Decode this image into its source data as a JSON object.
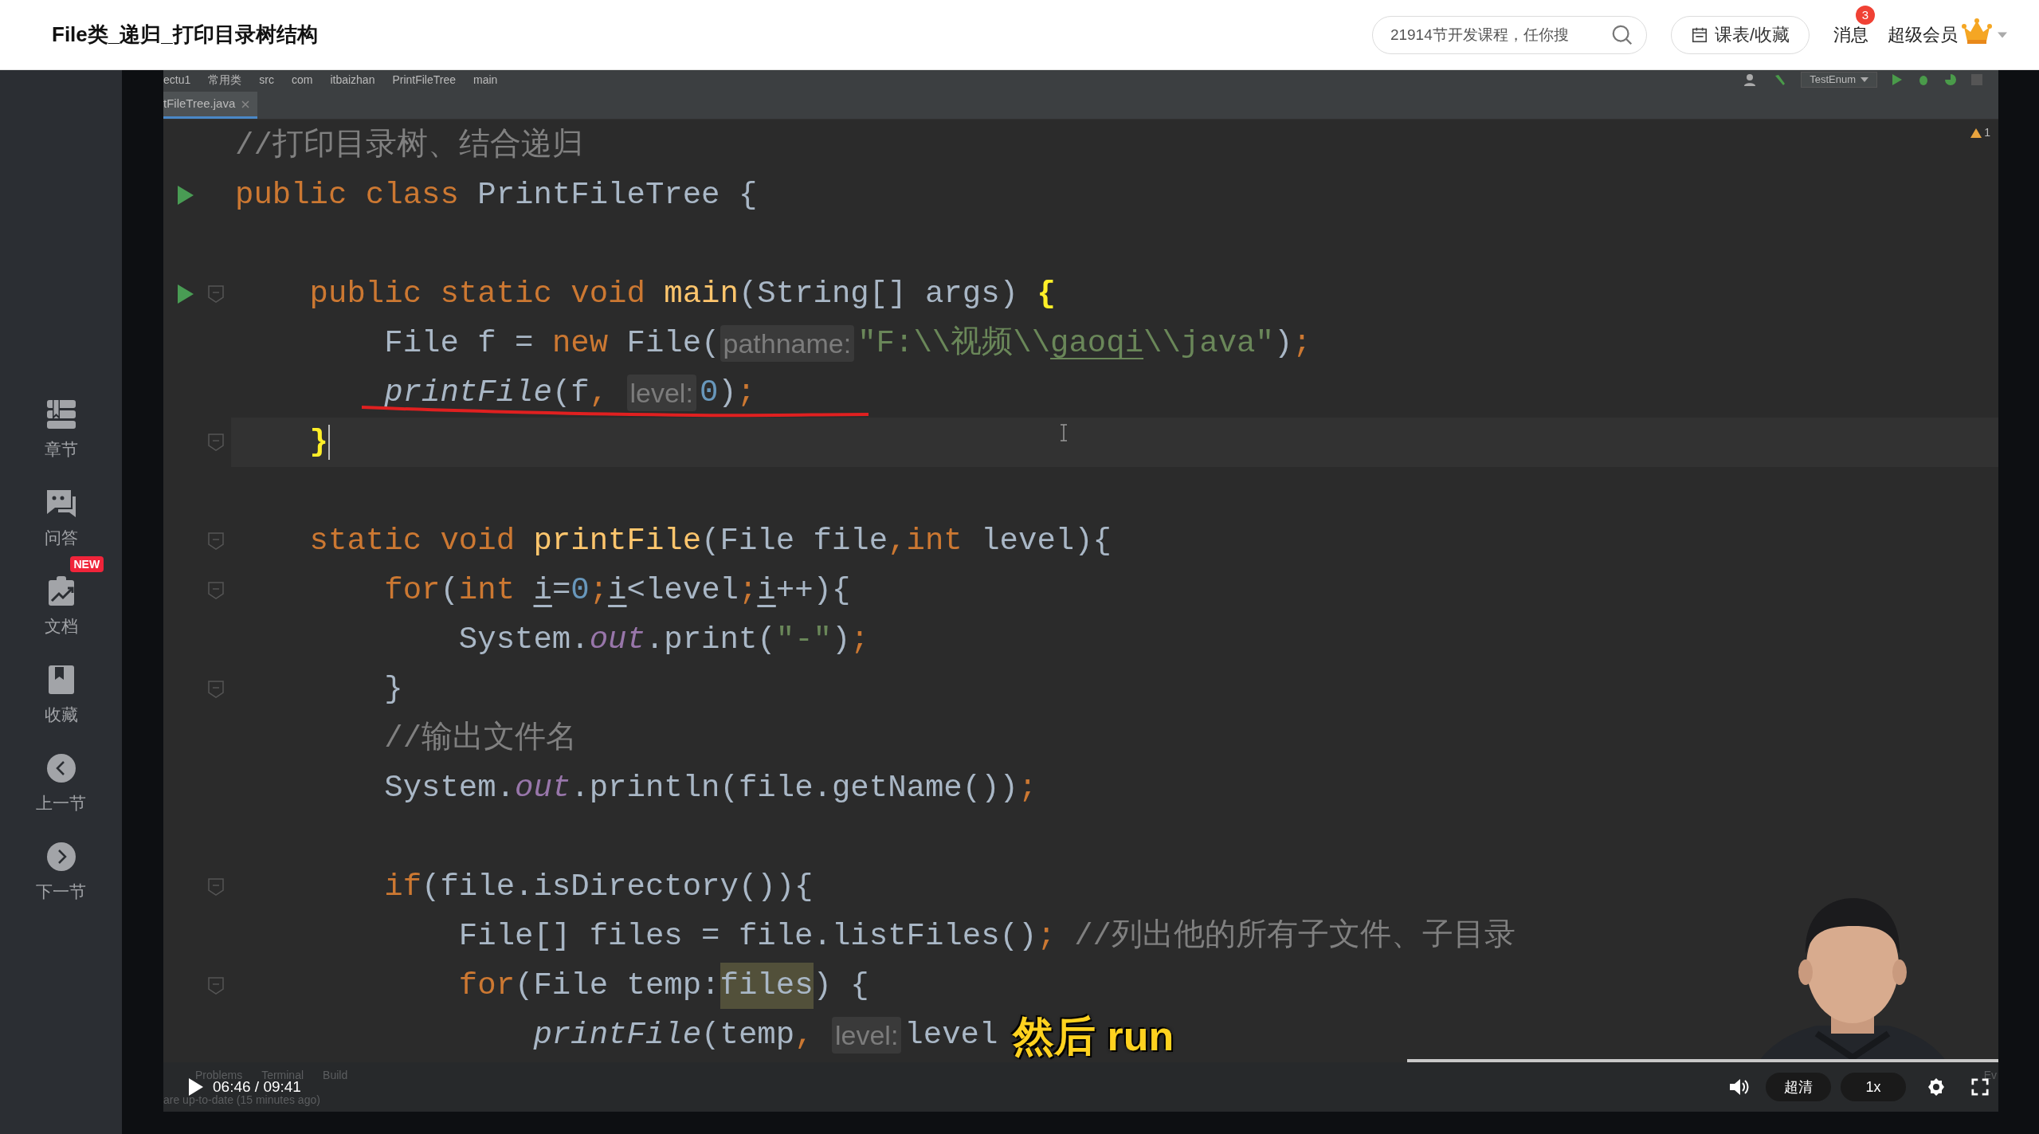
{
  "header": {
    "title": "File类_递归_打印目录树结构",
    "search": {
      "placeholder": "21914节开发课程，任你搜"
    },
    "schedule_button": "课表/收藏",
    "messages": {
      "label": "消息",
      "badge": "3"
    },
    "vip_label": "超级会员"
  },
  "sidebar": {
    "items": [
      {
        "kind": "chapters",
        "label": "章节"
      },
      {
        "kind": "qa",
        "label": "问答"
      },
      {
        "kind": "docs",
        "label": "文档",
        "badge": "NEW"
      },
      {
        "kind": "favorites",
        "label": "收藏"
      },
      {
        "kind": "prev",
        "label": "上一节"
      },
      {
        "kind": "next",
        "label": "下一节"
      }
    ]
  },
  "ide": {
    "breadcrumbs": [
      "ectu1",
      "常用类",
      "src",
      "com",
      "itbaizhan",
      "PrintFileTree",
      "main"
    ],
    "run_config": "TestEnum",
    "tab": {
      "label": "tFileTree.java",
      "selected": true
    },
    "warning_count": "1",
    "lines": [
      {
        "kind": "code",
        "run": false,
        "fold": false,
        "current": false,
        "tokens": [
          {
            "kind": "comment",
            "text": "//打印目录树、结合递归"
          }
        ]
      },
      {
        "kind": "code",
        "run": true,
        "fold": false,
        "current": false,
        "tokens": [
          {
            "kind": "keyword",
            "text": "public class"
          },
          {
            "kind": "plain",
            "text": " PrintFileTree {"
          }
        ]
      },
      {
        "kind": "blank"
      },
      {
        "kind": "code",
        "run": true,
        "fold": true,
        "current": false,
        "tokens": [
          {
            "kind": "keyword",
            "text": "    public static void "
          },
          {
            "kind": "method",
            "text": "main"
          },
          {
            "kind": "plain",
            "text": "(String[] args) "
          },
          {
            "kind": "match",
            "text": "{"
          }
        ]
      },
      {
        "kind": "code",
        "run": false,
        "fold": false,
        "current": false,
        "tokens": [
          {
            "kind": "plain",
            "text": "        File f = "
          },
          {
            "kind": "keyword",
            "text": "new"
          },
          {
            "kind": "plain",
            "text": " File("
          },
          {
            "kind": "hint",
            "text": "pathname:"
          },
          {
            "kind": "string",
            "text": "\"F:\\\\视频\\\\"
          },
          {
            "kind": "typo",
            "text": "gaoqi"
          },
          {
            "kind": "string",
            "text": "\\\\java\""
          },
          {
            "kind": "plain",
            "text": ")"
          },
          {
            "kind": "keyword",
            "text": ";"
          }
        ]
      },
      {
        "kind": "code",
        "run": false,
        "fold": false,
        "current": false,
        "tokens": [
          {
            "kind": "call",
            "text": "        printFile"
          },
          {
            "kind": "plain",
            "text": "(f"
          },
          {
            "kind": "keyword",
            "text": ", "
          },
          {
            "kind": "hint",
            "text": "level:"
          },
          {
            "kind": "number",
            "text": "0"
          },
          {
            "kind": "plain",
            "text": ")"
          },
          {
            "kind": "keyword",
            "text": ";"
          }
        ]
      },
      {
        "kind": "code",
        "run": false,
        "fold": true,
        "current": true,
        "tokens": [
          {
            "kind": "match",
            "text": "    }"
          }
        ]
      },
      {
        "kind": "blank"
      },
      {
        "kind": "code",
        "run": false,
        "fold": true,
        "current": false,
        "tokens": [
          {
            "kind": "keyword",
            "text": "    static void "
          },
          {
            "kind": "method",
            "text": "printFile"
          },
          {
            "kind": "plain",
            "text": "(File file"
          },
          {
            "kind": "keyword",
            "text": ",int"
          },
          {
            "kind": "plain",
            "text": " level){"
          }
        ]
      },
      {
        "kind": "code",
        "run": false,
        "fold": true,
        "current": false,
        "tokens": [
          {
            "kind": "keyword",
            "text": "        for"
          },
          {
            "kind": "plain",
            "text": "("
          },
          {
            "kind": "keyword",
            "text": "int "
          },
          {
            "kind": "reassigned",
            "text": "i"
          },
          {
            "kind": "plain",
            "text": "="
          },
          {
            "kind": "number",
            "text": "0"
          },
          {
            "kind": "keyword",
            "text": ";"
          },
          {
            "kind": "reassigned",
            "text": "i"
          },
          {
            "kind": "plain",
            "text": "<level"
          },
          {
            "kind": "keyword",
            "text": ";"
          },
          {
            "kind": "reassigned",
            "text": "i"
          },
          {
            "kind": "plain",
            "text": "++){"
          }
        ]
      },
      {
        "kind": "code",
        "run": false,
        "fold": false,
        "current": false,
        "tokens": [
          {
            "kind": "plain",
            "text": "            System."
          },
          {
            "kind": "field",
            "text": "out"
          },
          {
            "kind": "plain",
            "text": ".print("
          },
          {
            "kind": "string",
            "text": "\"-\""
          },
          {
            "kind": "plain",
            "text": ")"
          },
          {
            "kind": "keyword",
            "text": ";"
          }
        ]
      },
      {
        "kind": "code",
        "run": false,
        "fold": true,
        "current": false,
        "tokens": [
          {
            "kind": "plain",
            "text": "        }"
          }
        ]
      },
      {
        "kind": "code",
        "run": false,
        "fold": false,
        "current": false,
        "tokens": [
          {
            "kind": "comment",
            "text": "        //输出文件名"
          }
        ]
      },
      {
        "kind": "code",
        "run": false,
        "fold": false,
        "current": false,
        "tokens": [
          {
            "kind": "plain",
            "text": "        System."
          },
          {
            "kind": "field",
            "text": "out"
          },
          {
            "kind": "plain",
            "text": ".println(file.getName())"
          },
          {
            "kind": "keyword",
            "text": ";"
          }
        ]
      },
      {
        "kind": "blank"
      },
      {
        "kind": "code",
        "run": false,
        "fold": true,
        "current": false,
        "tokens": [
          {
            "kind": "keyword",
            "text": "        if"
          },
          {
            "kind": "plain",
            "text": "(file.isDirectory()){"
          }
        ]
      },
      {
        "kind": "code",
        "run": false,
        "fold": false,
        "current": false,
        "tokens": [
          {
            "kind": "plain",
            "text": "            File[] files = file.listFiles()"
          },
          {
            "kind": "keyword",
            "text": ";"
          },
          {
            "kind": "comment",
            "text": " //列出他的所有子文件、子目录"
          }
        ]
      },
      {
        "kind": "code",
        "run": false,
        "fold": true,
        "current": false,
        "tokens": [
          {
            "kind": "keyword",
            "text": "            for"
          },
          {
            "kind": "plain",
            "text": "(File temp:"
          },
          {
            "kind": "usage",
            "text": "files"
          },
          {
            "kind": "plain",
            "text": ") {"
          }
        ]
      },
      {
        "kind": "code",
        "run": false,
        "fold": false,
        "current": false,
        "tokens": [
          {
            "kind": "call",
            "text": "                printFile"
          },
          {
            "kind": "plain",
            "text": "(temp"
          },
          {
            "kind": "keyword",
            "text": ", "
          },
          {
            "kind": "hint",
            "text": "level:"
          },
          {
            "kind": "plain",
            "text": "level"
          }
        ]
      }
    ],
    "status_tools": [
      "Problems",
      "Terminal",
      "Build"
    ],
    "status_message": "are up-to-date (15 minutes ago)",
    "status_right": "Ev"
  },
  "player": {
    "playing": false,
    "time": "06:46 / 09:41",
    "quality": "超清",
    "speed": "1x",
    "subtitle": "然后 run"
  }
}
